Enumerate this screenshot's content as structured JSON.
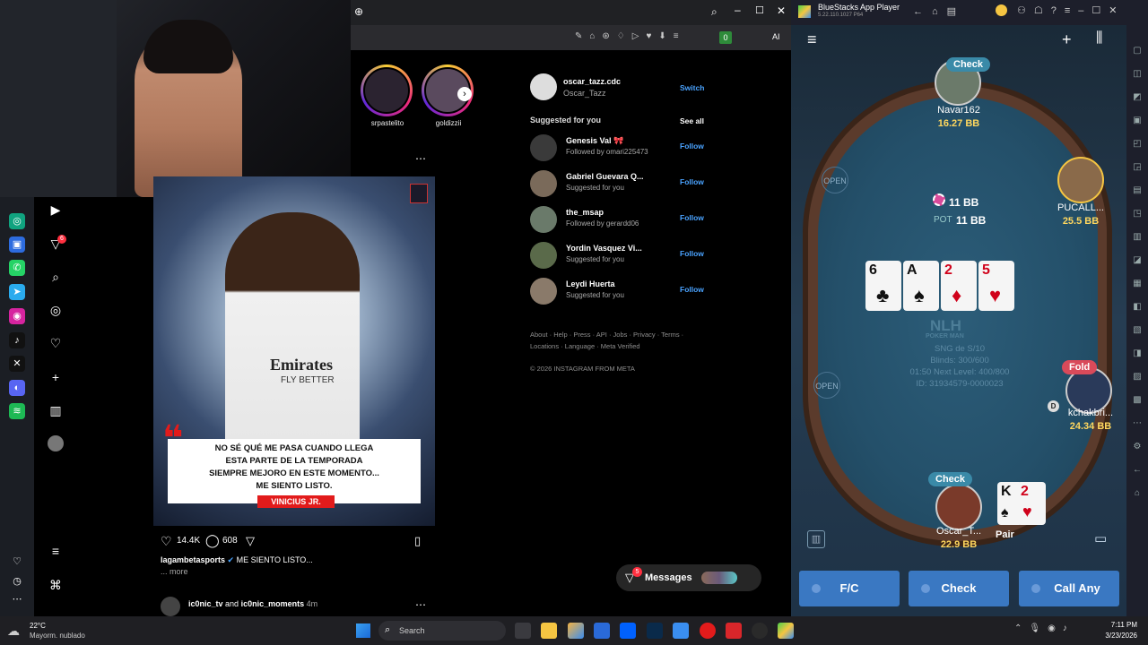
{
  "browser": {
    "menu_ai": "AI",
    "ext_badge": "0"
  },
  "stories": [
    {
      "name": "srpastelito"
    },
    {
      "name": "goldizzii"
    }
  ],
  "post": {
    "quote_lines": [
      "NO SÉ QUÉ ME PASA CUANDO LLEGA",
      "ESTA PARTE DE LA TEMPORADA",
      "SIEMPRE MEJORO EN ESTE MOMENTO...",
      "ME SIENTO LISTO."
    ],
    "tag": "VINICIUS JR.",
    "likes": "14.4K",
    "comments": "608",
    "author": "lagambetasports",
    "caption": "ME SIENTO LISTO...",
    "more": "... more",
    "next_author_a": "ic0nic_tv",
    "next_and": "and",
    "next_author_b": "ic0nic_moments",
    "next_time": "4m",
    "jersey": "Emirates",
    "jersey2": "FLY BETTER"
  },
  "account": {
    "username": "oscar_tazz.cdc",
    "name": "Oscar_Tazz",
    "switch": "Switch"
  },
  "suggested": {
    "title": "Suggested for you",
    "see_all": "See all",
    "follow": "Follow",
    "items": [
      {
        "name": "Genesis Val 🎀",
        "sub": "Followed by omari225473"
      },
      {
        "name": "Gabriel Guevara Q...",
        "sub": "Suggested for you"
      },
      {
        "name": "the_msap",
        "sub": "Followed by gerardd06"
      },
      {
        "name": "Yordin Vasquez Vi...",
        "sub": "Suggested for you"
      },
      {
        "name": "Leydi Huerta",
        "sub": "Suggested for you"
      }
    ]
  },
  "footer": {
    "line1": "About · Help · Press · API · Jobs · Privacy · Terms ·",
    "line2": "Locations · Language · Meta Verified",
    "copyright": "© 2026 INSTAGRAM FROM META"
  },
  "messages": {
    "label": "Messages",
    "badge": "5"
  },
  "notif_badge": "6",
  "bluestacks": {
    "title": "BlueStacks App Player",
    "version": "5.22.110.1027 P64"
  },
  "poker": {
    "players": [
      {
        "name": "Navar162",
        "bb": "16.27 BB",
        "status": "Check"
      },
      {
        "name": "PUCALL...",
        "bb": "25.5 BB",
        "status": ""
      },
      {
        "name": "kchakbri...",
        "bb": "24.34 BB",
        "status": "Fold"
      },
      {
        "name": "Oscar_T...",
        "bb": "22.9 BB",
        "status": "Check"
      }
    ],
    "bet": "11 BB",
    "pot_label": "POT",
    "pot": "11 BB",
    "board": [
      {
        "rank": "6",
        "suit": "♣",
        "red": false
      },
      {
        "rank": "A",
        "suit": "♠",
        "red": false
      },
      {
        "rank": "2",
        "suit": "♦",
        "red": true
      },
      {
        "rank": "5",
        "suit": "♥",
        "red": true
      }
    ],
    "hole": [
      {
        "rank": "K",
        "suit": "♠",
        "red": false
      },
      {
        "rank": "2",
        "suit": "♥",
        "red": true
      }
    ],
    "hand": "Pair",
    "logo": "NLH",
    "logo_sub": "POKER MAN",
    "info": [
      "SNG de S/10",
      "Blinds: 300/600",
      "01:50 Next Level: 400/800",
      "ID: 31934579-0000023"
    ],
    "open": "OPEN",
    "dealer": "D",
    "actions": {
      "fc": "F/C",
      "check": "Check",
      "call_any": "Call Any"
    }
  },
  "taskbar": {
    "weather_temp": "22°C",
    "weather_desc": "Mayorm. nublado",
    "search": "Search",
    "time": "7:11 PM",
    "date": "3/23/2026"
  }
}
